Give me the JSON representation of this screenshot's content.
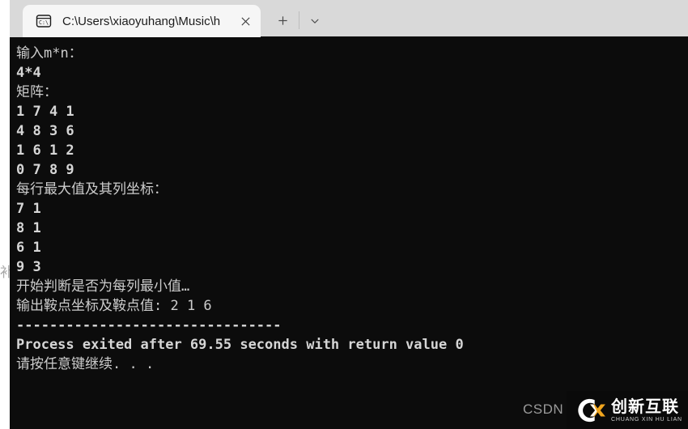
{
  "window": {
    "tab": {
      "icon": "console-cmd-icon",
      "title": "C:\\Users\\xiaoyuhang\\Music\\h",
      "close_label": "×"
    },
    "new_tab_label": "+",
    "dropdown_label": "⌄"
  },
  "console": {
    "background": "#0c0c0c",
    "foreground": "#cccccc",
    "lines": [
      {
        "text": "输入m*n：",
        "bold": false
      },
      {
        "text": "4*4",
        "bold": true
      },
      {
        "text": "矩阵：",
        "bold": false
      },
      {
        "text": "1 7 4 1",
        "bold": true
      },
      {
        "text": "4 8 3 6",
        "bold": true
      },
      {
        "text": "1 6 1 2",
        "bold": true
      },
      {
        "text": "0 7 8 9",
        "bold": true
      },
      {
        "text": "每行最大值及其列坐标：",
        "bold": false
      },
      {
        "text": "7 1",
        "bold": true
      },
      {
        "text": "8 1",
        "bold": true
      },
      {
        "text": "6 1",
        "bold": true
      },
      {
        "text": "9 3",
        "bold": true
      },
      {
        "text": "开始判断是否为每列最小值…",
        "bold": false
      },
      {
        "text": "输出鞍点坐标及鞍点值: 2 1 6",
        "bold": false
      },
      {
        "text": "--------------------------------",
        "bold": true
      },
      {
        "text": "Process exited after 69.55 seconds with return value 0",
        "bold": true
      },
      {
        "text": "请按任意键继续. . .",
        "bold": false
      }
    ]
  },
  "program_data": {
    "prompt": "输入m*n：",
    "dimensions_input": "4*4",
    "rows": 4,
    "cols": 4,
    "matrix_label": "矩阵：",
    "matrix": [
      [
        1,
        7,
        4,
        1
      ],
      [
        4,
        8,
        3,
        6
      ],
      [
        1,
        6,
        1,
        2
      ],
      [
        0,
        7,
        8,
        9
      ]
    ],
    "row_max_label": "每行最大值及其列坐标：",
    "row_max": [
      {
        "value": 7,
        "col": 1
      },
      {
        "value": 8,
        "col": 1
      },
      {
        "value": 6,
        "col": 1
      },
      {
        "value": 9,
        "col": 3
      }
    ],
    "checking_label": "开始判断是否为每列最小值…",
    "saddle_label": "输出鞍点坐标及鞍点值: 2 1 6",
    "saddle_row": 2,
    "saddle_col": 1,
    "saddle_value": 6,
    "exit_message": "Process exited after 69.55 seconds with return value 0",
    "exit_seconds": "69.55",
    "return_value": "0",
    "continue_message": "请按任意键继续. . ."
  },
  "page_bleed": {
    "text": "补"
  },
  "watermarks": {
    "csdn": "CSDN",
    "brand_cn": "创新互联",
    "brand_en": "CHUANG XIN HU LIAN",
    "brand_accent": "#f0a51e"
  }
}
